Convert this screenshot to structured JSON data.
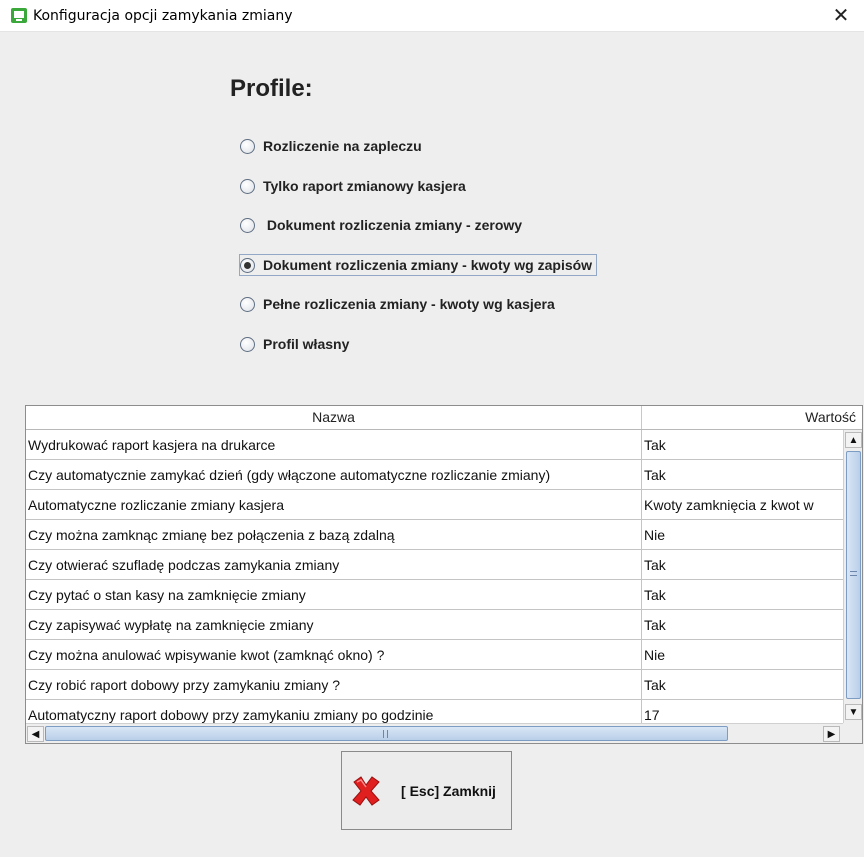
{
  "window": {
    "title": "Konfiguracja opcji zamykania zmiany",
    "close_glyph": "✕",
    "app_icon": "app-window-icon",
    "accent": "#3aa83a"
  },
  "profiles": {
    "heading": "Profile:",
    "options": [
      {
        "label": "Rozliczenie na zapleczu",
        "checked": false
      },
      {
        "label": "Tylko raport zmianowy kasjera",
        "checked": false
      },
      {
        "label": " Dokument rozliczenia zmiany - zerowy",
        "checked": false
      },
      {
        "label": "Dokument rozliczenia zmiany - kwoty wg zapisów",
        "checked": true
      },
      {
        "label": "Pełne rozliczenia zmiany - kwoty wg kasjera",
        "checked": false
      },
      {
        "label": "Profil własny",
        "checked": false
      }
    ]
  },
  "table": {
    "headers": {
      "name": "Nazwa",
      "value": "Wartość"
    },
    "rows": [
      {
        "name": "Wydrukować raport kasjera na drukarce",
        "value": "Tak"
      },
      {
        "name": "Czy automatycznie zamykać dzień (gdy włączone automatyczne rozliczanie zmiany)",
        "value": "Tak"
      },
      {
        "name": "Automatyczne rozliczanie zmiany kasjera",
        "value": "Kwoty zamknięcia z kwot w"
      },
      {
        "name": "Czy można zamknąc zmianę bez połączenia z bazą zdalną",
        "value": "Nie"
      },
      {
        "name": "Czy otwierać szufladę podczas zamykania zmiany",
        "value": "Tak"
      },
      {
        "name": "Czy pytać o stan kasy na zamknięcie zmiany",
        "value": "Tak"
      },
      {
        "name": "Czy zapisywać wypłatę na zamknięcie zmiany",
        "value": "Tak"
      },
      {
        "name": "Czy można anulować wpisywanie kwot (zamknąć okno) ?",
        "value": "Nie"
      },
      {
        "name": "Czy robić raport dobowy przy zamykaniu zmiany ?",
        "value": "Tak"
      },
      {
        "name": "Automatyczny raport dobowy przy zamykaniu zmiany po godzinie",
        "value": "17"
      }
    ]
  },
  "scrollbar": {
    "up": "▲",
    "down": "▼",
    "left": "◀",
    "right": "▶"
  },
  "close_button": {
    "label": "[ Esc] Zamknij",
    "icon": "red-x-icon"
  }
}
